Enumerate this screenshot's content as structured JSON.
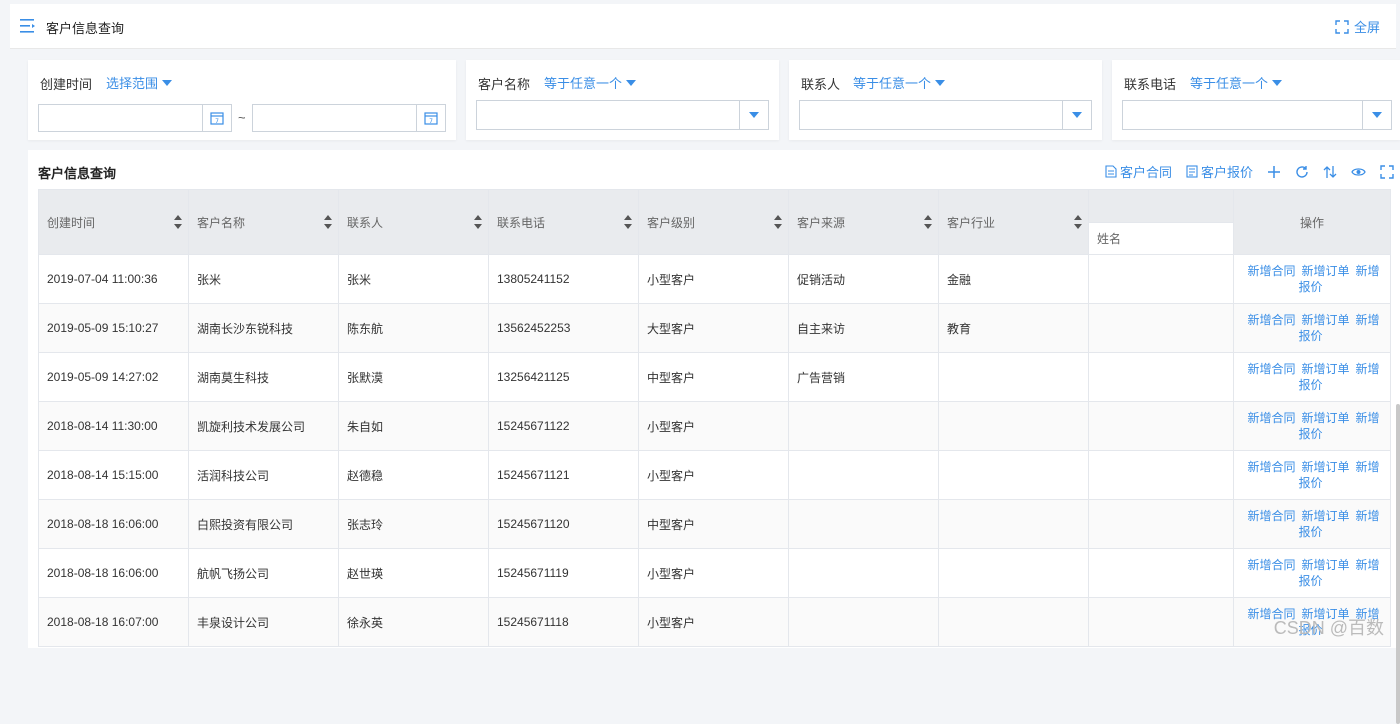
{
  "page": {
    "title": "客户信息查询",
    "fullscreen_label": "全屏"
  },
  "filters": {
    "created_time": {
      "label": "创建时间",
      "operator": "选择范围",
      "from_value": "",
      "to_value": "",
      "separator": "~"
    },
    "customer_name": {
      "label": "客户名称",
      "operator": "等于任意一个",
      "value": ""
    },
    "contact": {
      "label": "联系人",
      "operator": "等于任意一个",
      "value": ""
    },
    "phone": {
      "label": "联系电话",
      "operator": "等于任意一个",
      "value": ""
    }
  },
  "grid": {
    "title": "客户信息查询",
    "toolbar": {
      "contract_label": "客户合同",
      "quote_label": "客户报价"
    },
    "columns": [
      "创建时间",
      "客户名称",
      "联系人",
      "联系电话",
      "客户级别",
      "客户来源",
      "客户行业",
      "",
      "操作"
    ],
    "sub_header": "姓名",
    "actions": {
      "add_contract": "新增合同",
      "add_order": "新增订单",
      "add_quote": "新增报价"
    },
    "rows": [
      {
        "created": "2019-07-04 11:00:36",
        "name": "张米",
        "contact": "张米",
        "phone": "13805241152",
        "level": "小型客户",
        "source": "促销活动",
        "industry": "金融",
        "person": ""
      },
      {
        "created": "2019-05-09 15:10:27",
        "name": "湖南长沙东锐科技",
        "contact": "陈东航",
        "phone": "13562452253",
        "level": "大型客户",
        "source": "自主来访",
        "industry": "教育",
        "person": ""
      },
      {
        "created": "2019-05-09 14:27:02",
        "name": "湖南莫生科技",
        "contact": "张默漠",
        "phone": "13256421125",
        "level": "中型客户",
        "source": "广告营销",
        "industry": "",
        "person": ""
      },
      {
        "created": "2018-08-14 11:30:00",
        "name": "凯旋利技术发展公司",
        "contact": "朱自如",
        "phone": "15245671122",
        "level": "小型客户",
        "source": "",
        "industry": "",
        "person": ""
      },
      {
        "created": "2018-08-14 15:15:00",
        "name": "活润科技公司",
        "contact": "赵德稳",
        "phone": "15245671121",
        "level": "小型客户",
        "source": "",
        "industry": "",
        "person": ""
      },
      {
        "created": "2018-08-18 16:06:00",
        "name": "白熙投资有限公司",
        "contact": "张志玲",
        "phone": "15245671120",
        "level": "中型客户",
        "source": "",
        "industry": "",
        "person": ""
      },
      {
        "created": "2018-08-18 16:06:00",
        "name": "航帆飞扬公司",
        "contact": "赵世瑛",
        "phone": "15245671119",
        "level": "小型客户",
        "source": "",
        "industry": "",
        "person": ""
      },
      {
        "created": "2018-08-18 16:07:00",
        "name": "丰泉设计公司",
        "contact": "徐永英",
        "phone": "15245671118",
        "level": "小型客户",
        "source": "",
        "industry": "",
        "person": ""
      }
    ]
  },
  "watermark": "CSDN @百数",
  "colors": {
    "accent": "#3a8ee6",
    "header_bg": "#e9ebee",
    "border": "#e4e7ec"
  }
}
